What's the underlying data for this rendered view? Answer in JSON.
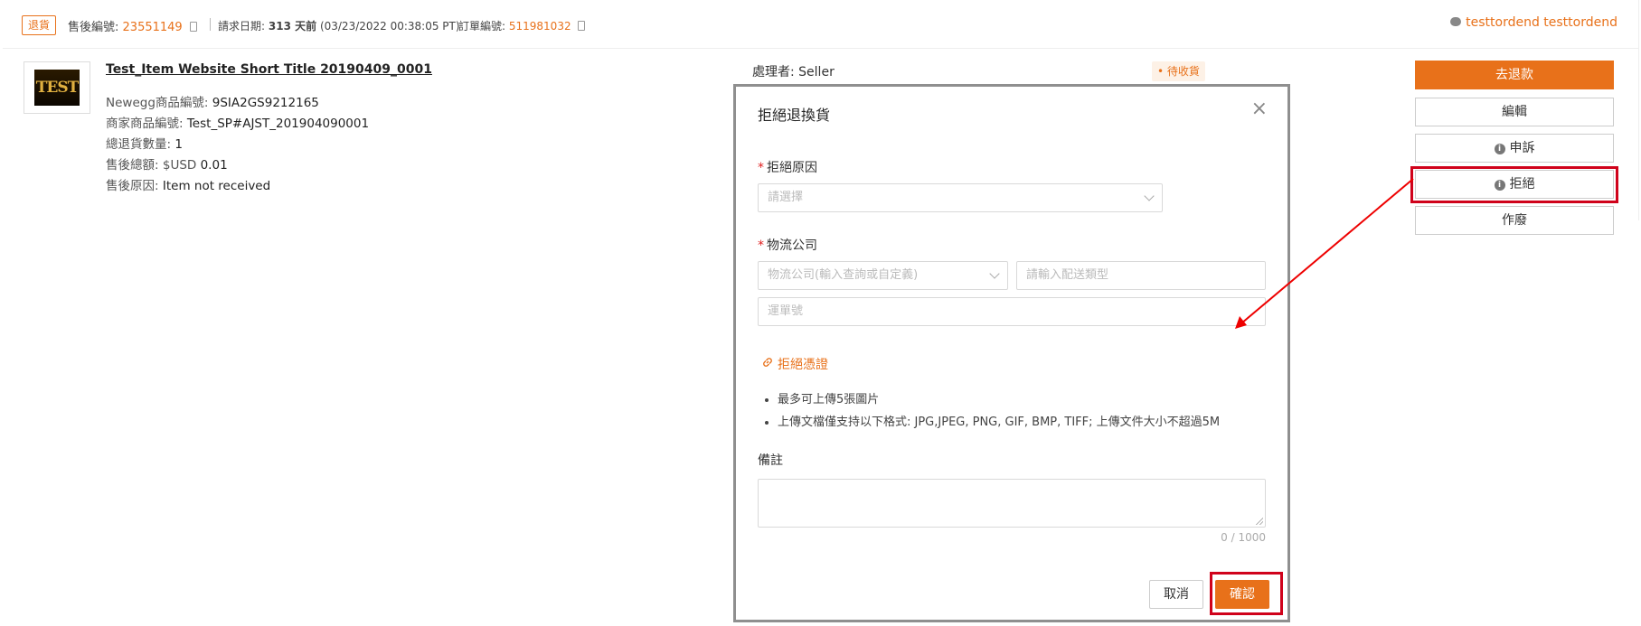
{
  "header": {
    "type_tag": "退貨",
    "after_sale_label": "售後編號:",
    "after_sale_number": "23551149",
    "request_date_label": "請求日期:",
    "request_days": "313 天前",
    "request_datetime": "(03/23/2022 00:38:05 PT)",
    "order_label": "訂單編號:",
    "order_number": "511981032",
    "user": "testtordend testtordend"
  },
  "item": {
    "thumb_text": "TEST",
    "title": "Test_Item Website Short Title 20190409_0001",
    "newegg_label": "Newegg商品編號:",
    "newegg_value": "9SIA2GS9212165",
    "seller_label": "商家商品編號:",
    "seller_value": "Test_SP#AJST_201904090001",
    "qty_label": "總退貨數量:",
    "qty_value": "1",
    "total_label": "售後總額:",
    "total_currency": "$USD",
    "total_value": "0.01",
    "reason_label": "售後原因:",
    "reason_value": "Item not received",
    "handler_label": "處理者:",
    "handler_value": "Seller",
    "status": "• 待收貨"
  },
  "actions": {
    "refund": "去退款",
    "edit": "編輯",
    "appeal": "申訴",
    "reject": "拒絕",
    "void": "作廢"
  },
  "modal": {
    "title": "拒絕退換貨",
    "close": "×",
    "reason_label": "拒絕原因",
    "reason_placeholder": "請選擇",
    "logistics_label": "物流公司",
    "logistics_placeholder": "物流公司(輸入查詢或自定義)",
    "ship_type_placeholder": "請輸入配送類型",
    "tracking_placeholder": "運單號",
    "evidence_link": "拒絕憑證",
    "rules": [
      "最多可上傳5張圖片",
      "上傳文檔僅支持以下格式: JPG,JPEG, PNG, GIF, BMP, TIFF; 上傳文件大小不超過5M"
    ],
    "note_label": "備註",
    "counter": "0 / 1000",
    "cancel": "取消",
    "confirm": "確認"
  },
  "colors": {
    "accent": "#e8711a",
    "highlight": "#d0021b"
  }
}
